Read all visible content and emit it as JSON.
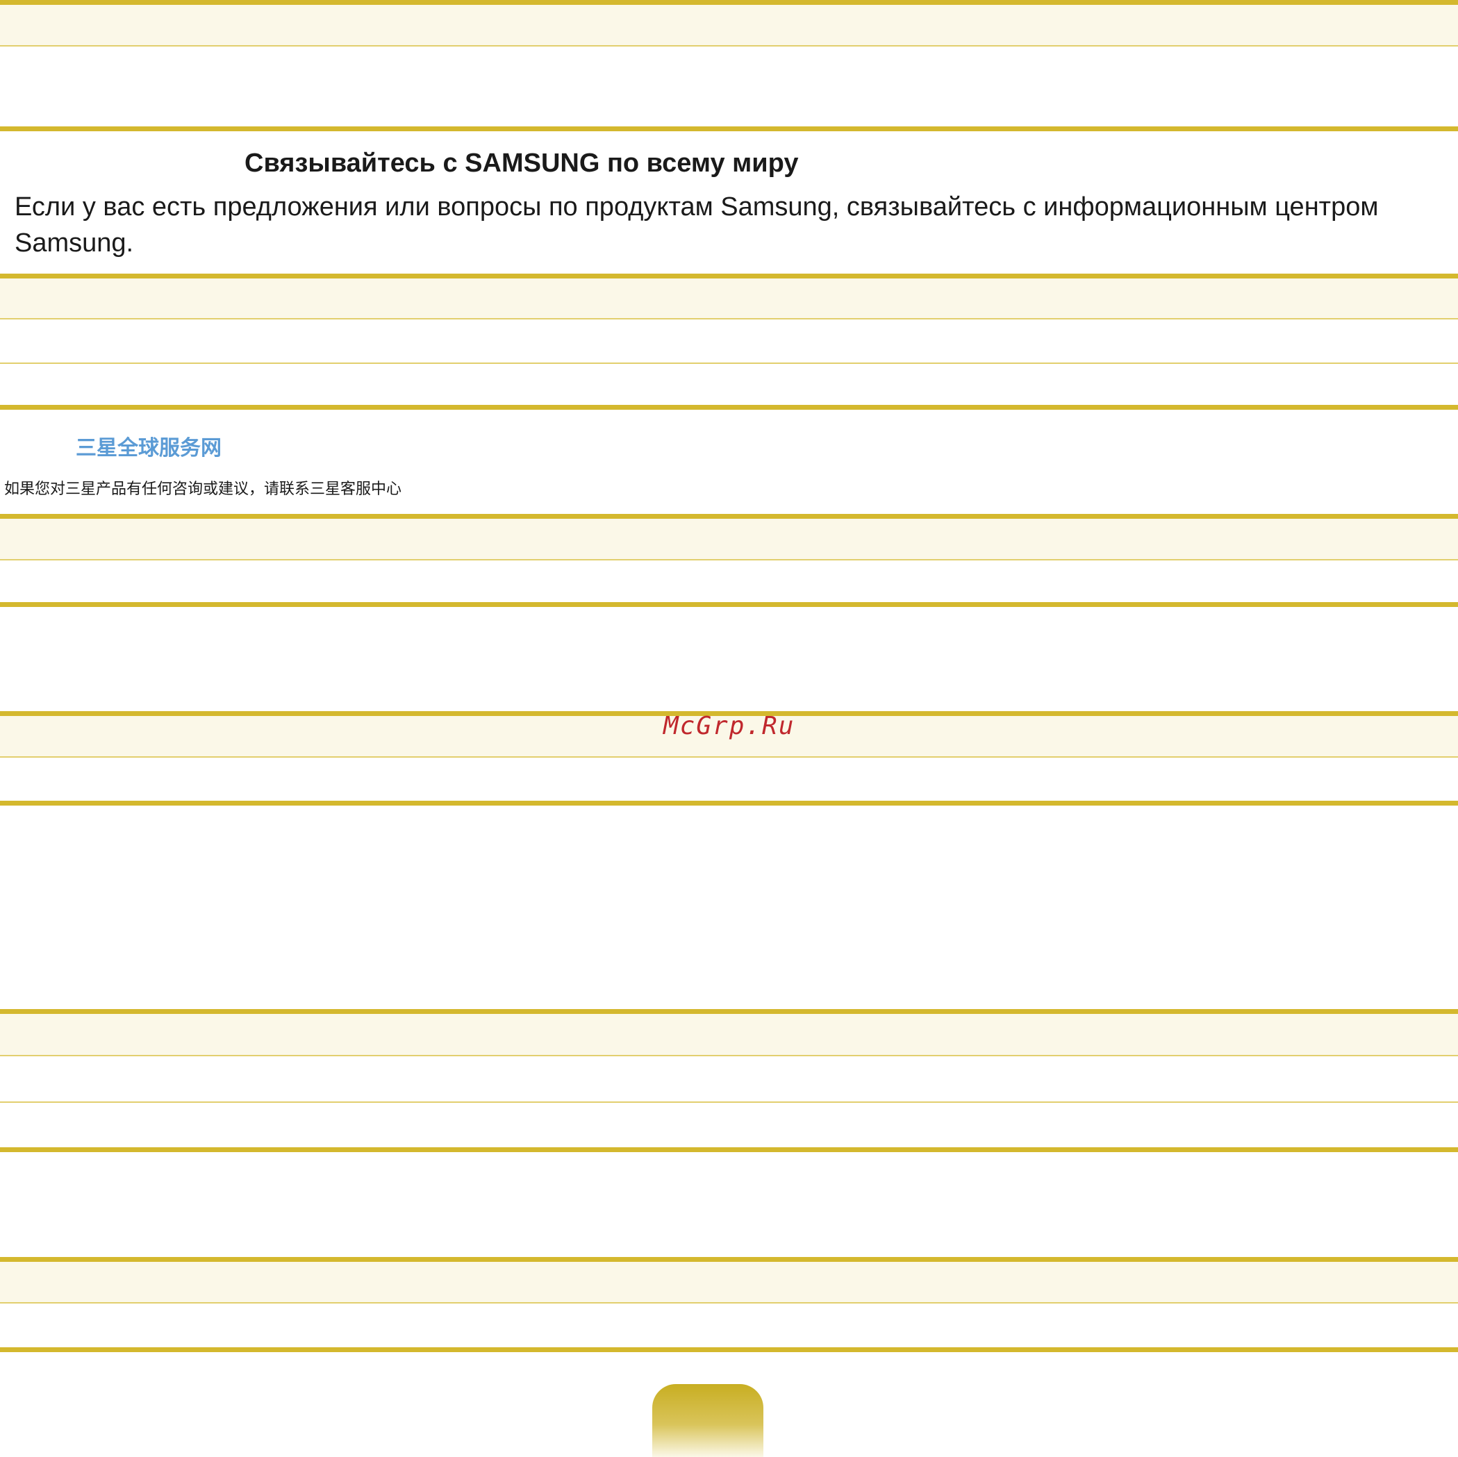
{
  "section": {
    "heading": "Связывайтесь с SAMSUNG по всему миру",
    "body": "Если у вас есть предложения или вопросы по продуктам Samsung, связывайтесь с информационным центром Samsung."
  },
  "china_block": {
    "title": "三星全球服务网",
    "body": "如果您对三星产品有任何咨询或建议，请联系三星客服中心"
  },
  "watermark": "McGrp.Ru",
  "colors": {
    "rule": "#d4b82e",
    "band": "#fbf8e8",
    "cn_title": "#5b9bd5",
    "watermark": "#c0282d"
  }
}
